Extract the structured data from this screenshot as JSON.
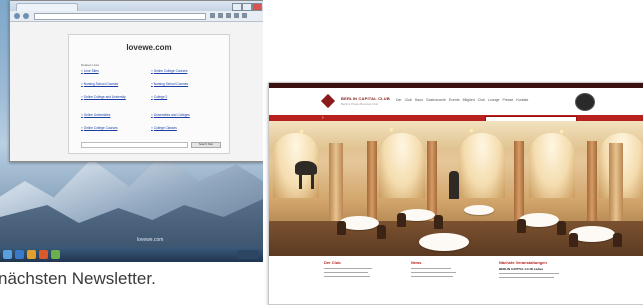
{
  "caption": "nächsten Newsletter.",
  "left_browser": {
    "site_title": "lovewe.com",
    "related_label": "Related Links",
    "links": [
      "Love Sites",
      "Online College Courses",
      "Nursing School Courses",
      "Nursing School Courses",
      "Online College and University",
      "College 2",
      "Online Universities",
      "Universities and Colleges",
      "Online College Courses",
      "College Classes"
    ],
    "search_button": "Search Now",
    "desktop_label": "lovewe.com"
  },
  "right_site": {
    "brand": "BERLIN CAPITAL CLUB",
    "brand_sub": "Berlin's Private Business Club",
    "nav": "Der Club  Haus  Gastronomie  Events  Mitglied  Club Lounge  Presse  Kontakt",
    "badge_label": "BERLIN CAPITAL CLUB",
    "columns": [
      {
        "title": "Der Club",
        "strong": ""
      },
      {
        "title": "News",
        "strong": ""
      },
      {
        "title": "Nächste Veranstaltungen",
        "strong": "BERLIN CAPITAL CLUB Ladies"
      }
    ]
  },
  "colors": {
    "club_red": "#b7201c",
    "club_dark": "#3a1110",
    "link_blue": "#1a3ea6"
  }
}
